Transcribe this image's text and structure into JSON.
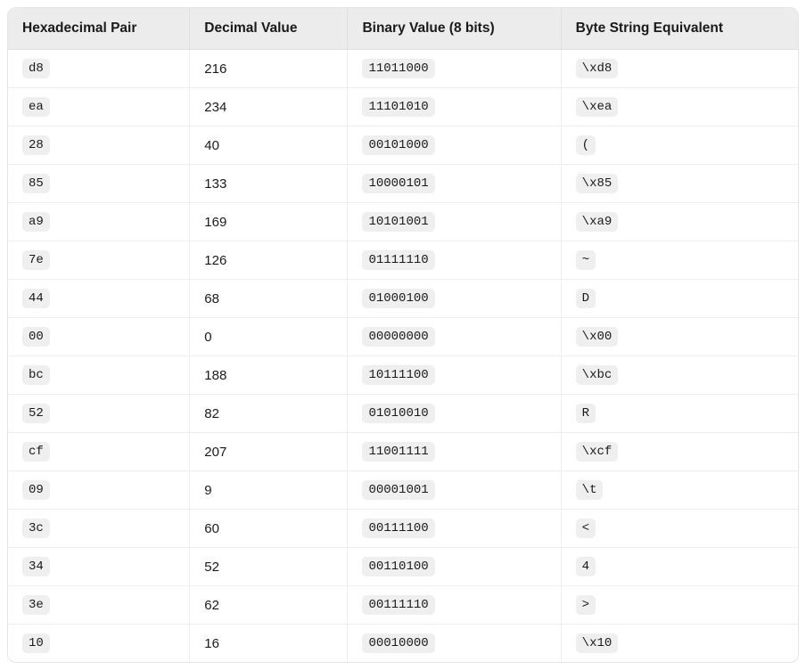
{
  "table": {
    "headers": {
      "hex": "Hexadecimal Pair",
      "dec": "Decimal Value",
      "bin": "Binary Value (8 bits)",
      "byte": "Byte String Equivalent"
    },
    "rows": [
      {
        "hex": "d8",
        "dec": "216",
        "bin": "11011000",
        "byte": "\\xd8"
      },
      {
        "hex": "ea",
        "dec": "234",
        "bin": "11101010",
        "byte": "\\xea"
      },
      {
        "hex": "28",
        "dec": "40",
        "bin": "00101000",
        "byte": "("
      },
      {
        "hex": "85",
        "dec": "133",
        "bin": "10000101",
        "byte": "\\x85"
      },
      {
        "hex": "a9",
        "dec": "169",
        "bin": "10101001",
        "byte": "\\xa9"
      },
      {
        "hex": "7e",
        "dec": "126",
        "bin": "01111110",
        "byte": "~"
      },
      {
        "hex": "44",
        "dec": "68",
        "bin": "01000100",
        "byte": "D"
      },
      {
        "hex": "00",
        "dec": "0",
        "bin": "00000000",
        "byte": "\\x00"
      },
      {
        "hex": "bc",
        "dec": "188",
        "bin": "10111100",
        "byte": "\\xbc"
      },
      {
        "hex": "52",
        "dec": "82",
        "bin": "01010010",
        "byte": "R"
      },
      {
        "hex": "cf",
        "dec": "207",
        "bin": "11001111",
        "byte": "\\xcf"
      },
      {
        "hex": "09",
        "dec": "9",
        "bin": "00001001",
        "byte": "\\t"
      },
      {
        "hex": "3c",
        "dec": "60",
        "bin": "00111100",
        "byte": "<"
      },
      {
        "hex": "34",
        "dec": "52",
        "bin": "00110100",
        "byte": "4"
      },
      {
        "hex": "3e",
        "dec": "62",
        "bin": "00111110",
        "byte": ">"
      },
      {
        "hex": "10",
        "dec": "16",
        "bin": "00010000",
        "byte": "\\x10"
      }
    ]
  }
}
